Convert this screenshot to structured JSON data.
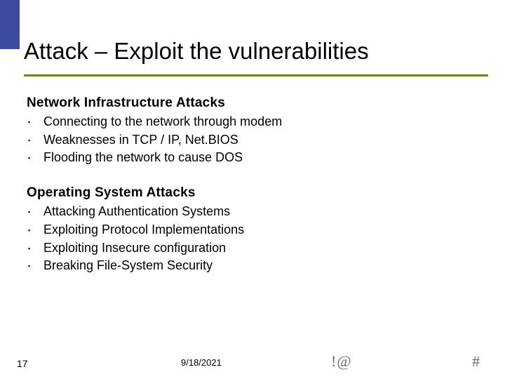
{
  "title": "Attack – Exploit the vulnerabilities",
  "section1": {
    "heading": "Network Infrastructure Attacks",
    "items": [
      "Connecting to the network through modem",
      "Weaknesses in TCP / IP, Net.BIOS",
      "Flooding the network to cause DOS"
    ]
  },
  "section2": {
    "heading": "Operating System Attacks",
    "items": [
      "Attacking Authentication Systems",
      "Exploiting Protocol Implementations",
      "Exploiting Insecure configuration",
      "Breaking File-System Security"
    ]
  },
  "footer": {
    "page": "17",
    "date": "9/18/2021",
    "symbol1": "!@",
    "symbol2": "#"
  }
}
